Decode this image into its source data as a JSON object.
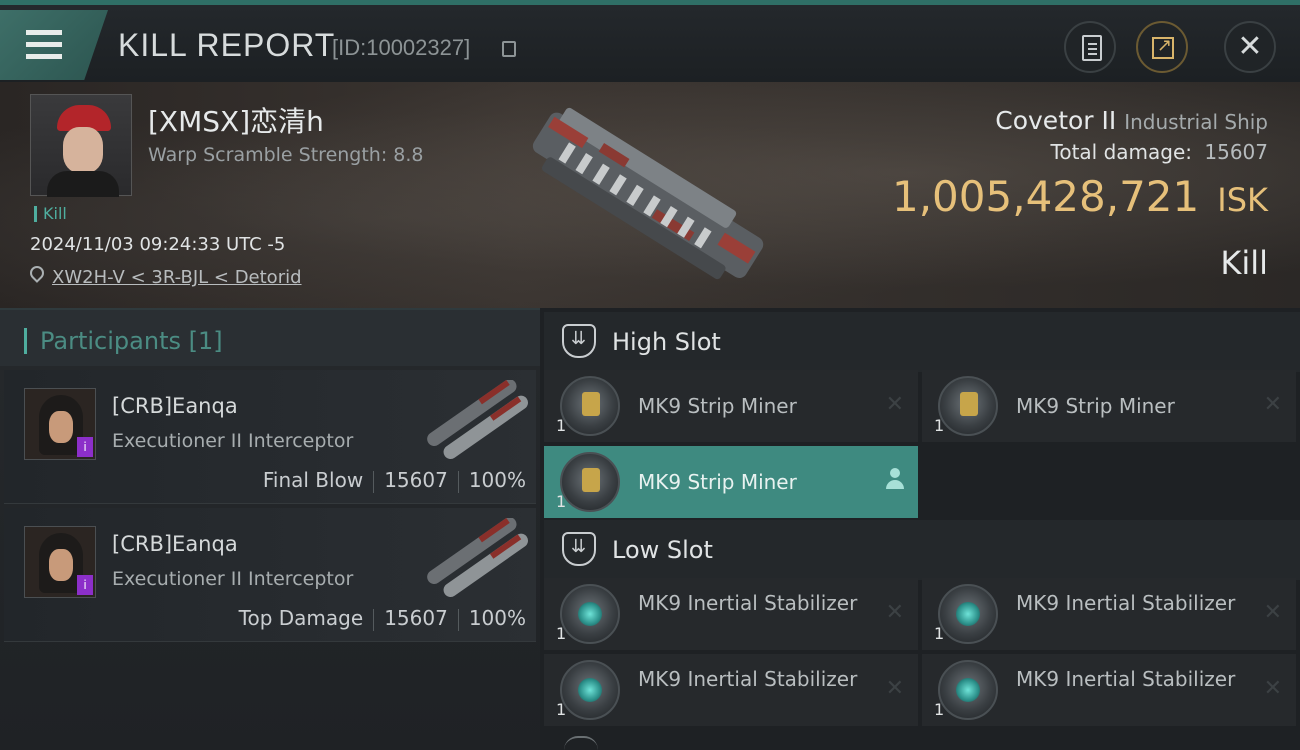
{
  "header": {
    "title": "KILL REPORT",
    "report_id": "[ID:10002327]"
  },
  "victim": {
    "name": "[XMSX]恋清h",
    "warp_scramble": "Warp Scramble Strength: 8.8",
    "kill_tag": "Kill",
    "timestamp": "2024/11/03 09:24:33 UTC -5",
    "location": "XW2H-V < 3R-BJL < Detorid",
    "ship_name": "Covetor II",
    "ship_class": "Industrial Ship",
    "total_damage_label": "Total damage:",
    "total_damage_value": "15607",
    "isk_value": "1,005,428,721",
    "isk_unit": "ISK",
    "result": "Kill"
  },
  "participants": {
    "title": "Participants [1]",
    "items": [
      {
        "name": "[CRB]Eanqa",
        "ship": "Executioner II Interceptor",
        "role": "Final Blow",
        "damage": "15607",
        "percent": "100%"
      },
      {
        "name": "[CRB]Eanqa",
        "ship": "Executioner II Interceptor",
        "role": "Top Damage",
        "damage": "15607",
        "percent": "100%"
      }
    ]
  },
  "fitting": {
    "high_slot_label": "High Slot",
    "low_slot_label": "Low Slot",
    "high": [
      {
        "name": "MK9 Strip Miner",
        "qty": "1"
      },
      {
        "name": "MK9 Strip Miner",
        "qty": "1"
      },
      {
        "name": "MK9 Strip Miner",
        "qty": "1"
      }
    ],
    "low": [
      {
        "name": "MK9 Inertial Stabilizer",
        "qty": "1"
      },
      {
        "name": "MK9 Inertial Stabilizer",
        "qty": "1"
      },
      {
        "name": "MK9 Inertial Stabilizer",
        "qty": "1"
      },
      {
        "name": "MK9 Inertial Stabilizer",
        "qty": "1"
      }
    ]
  },
  "colors": {
    "accent_teal": "#4fae9f",
    "isk_gold": "#e6c07a",
    "highlight_row": "#3e8a80"
  },
  "icons": {
    "menu": "hamburger-icon",
    "copy": "copy-icon",
    "clipboard": "clipboard-icon",
    "share": "share-icon",
    "close": "close-icon",
    "location": "map-pin-icon",
    "slot": "slot-shield-icon",
    "remove": "cross-icon",
    "pilot": "person-icon"
  }
}
